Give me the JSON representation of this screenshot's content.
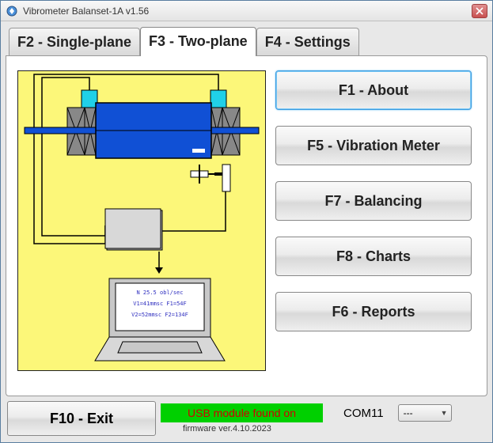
{
  "window": {
    "title": "Vibrometer Balanset-1A  v1.56"
  },
  "tabs": {
    "single_plane": "F2 - Single-plane",
    "two_plane": "F3 - Two-plane",
    "settings": "F4 - Settings",
    "active": "two_plane"
  },
  "buttons": {
    "about": "F1 - About",
    "vibration_meter": "F5 - Vibration Meter",
    "balancing": "F7 - Balancing",
    "charts": "F8 - Charts",
    "reports": "F6 - Reports",
    "exit": "F10 - Exit"
  },
  "status": {
    "usb_message": "USB module found on",
    "com_port": "COM11",
    "combo_value": "---",
    "firmware": "firmware ver.4.10.2023"
  },
  "diagram": {
    "screen_lines": [
      "N   25.5 obl/sec",
      "V1=41mmsc  F1=54F",
      "V2=52mmsc  F2=134F"
    ]
  },
  "colors": {
    "diagram_bg": "#fcf779",
    "rotor_blue": "#1050d5",
    "sensor_cyan": "#20d0e8",
    "usb_bg": "#00d000",
    "usb_text": "#d00000"
  }
}
